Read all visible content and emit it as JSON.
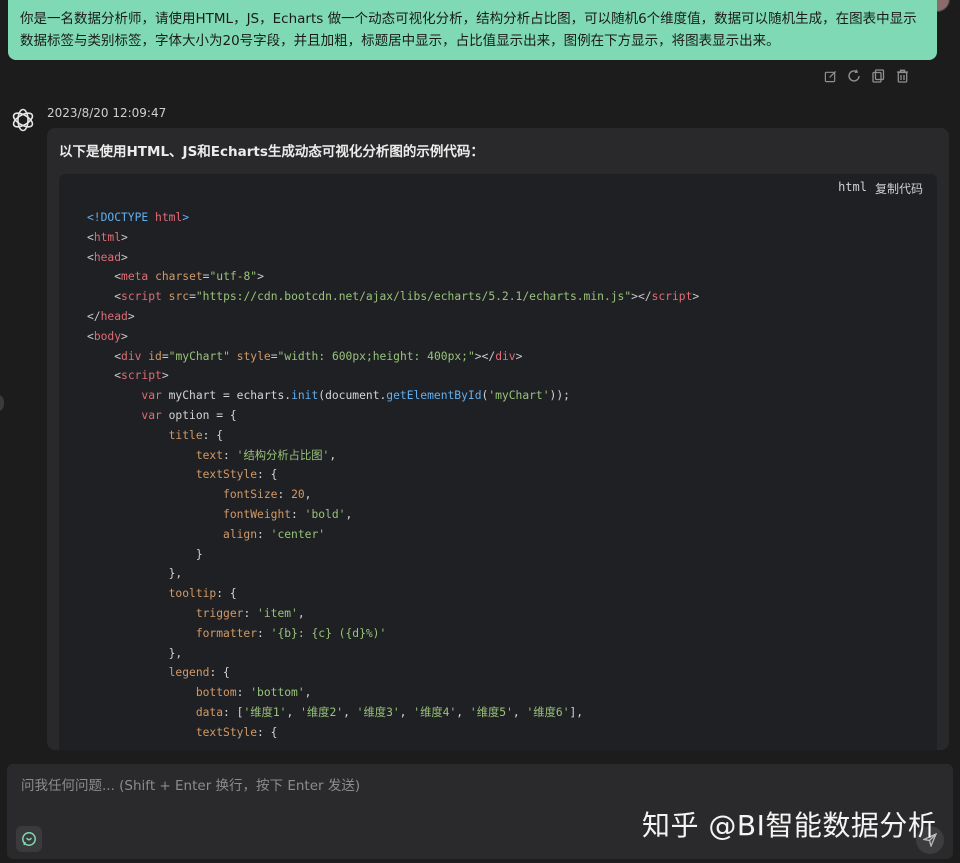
{
  "user_message": {
    "text": "你是一名数据分析师，请使用HTML，JS，Echarts 做一个动态可视化分析，结构分析占比图，可以随机6个维度值，数据可以随机生成，在图表中显示数据标签与类别标签，字体大小为20号字段，并且加粗，标题居中显示，占比值显示出来，图例在下方显示，将图表显示出来。",
    "background_color": "#7fd9b4"
  },
  "message_actions": [
    {
      "name": "edit-icon"
    },
    {
      "name": "regenerate-icon"
    },
    {
      "name": "copy-icon"
    },
    {
      "name": "delete-icon"
    }
  ],
  "assistant": {
    "logo_icon": "openai-logo-icon",
    "timestamp": "2023/8/20 12:09:47",
    "intro": "以下是使用HTML、JS和Echarts生成动态可视化分析图的示例代码：",
    "code_lang": "html",
    "copy_label": "复制代码",
    "code_lines": [
      [
        [
          "doctype",
          "<!DOCTYPE "
        ],
        [
          "tag",
          "html"
        ],
        [
          "doctype",
          ">"
        ]
      ],
      [
        [
          "punct",
          "<"
        ],
        [
          "tag",
          "html"
        ],
        [
          "punct",
          ">"
        ]
      ],
      [
        [
          "punct",
          "<"
        ],
        [
          "tag",
          "head"
        ],
        [
          "punct",
          ">"
        ]
      ],
      [
        [
          "plain",
          "    "
        ],
        [
          "punct",
          "<"
        ],
        [
          "tag",
          "meta"
        ],
        [
          "plain",
          " "
        ],
        [
          "attr",
          "charset"
        ],
        [
          "punct",
          "="
        ],
        [
          "str",
          "\"utf-8\""
        ],
        [
          "punct",
          ">"
        ]
      ],
      [
        [
          "plain",
          "    "
        ],
        [
          "punct",
          "<"
        ],
        [
          "tag",
          "script"
        ],
        [
          "plain",
          " "
        ],
        [
          "attr",
          "src"
        ],
        [
          "punct",
          "="
        ],
        [
          "str",
          "\"https://cdn.bootcdn.net/ajax/libs/echarts/5.2.1/echarts.min.js\""
        ],
        [
          "punct",
          "></"
        ],
        [
          "tag",
          "script"
        ],
        [
          "punct",
          ">"
        ]
      ],
      [
        [
          "punct",
          "</"
        ],
        [
          "tag",
          "head"
        ],
        [
          "punct",
          ">"
        ]
      ],
      [
        [
          "punct",
          "<"
        ],
        [
          "tag",
          "body"
        ],
        [
          "punct",
          ">"
        ]
      ],
      [
        [
          "plain",
          "    "
        ],
        [
          "punct",
          "<"
        ],
        [
          "tag",
          "div"
        ],
        [
          "plain",
          " "
        ],
        [
          "attr",
          "id"
        ],
        [
          "punct",
          "="
        ],
        [
          "str",
          "\"myChart\""
        ],
        [
          "plain",
          " "
        ],
        [
          "attr",
          "style"
        ],
        [
          "punct",
          "="
        ],
        [
          "str",
          "\"width: 600px;height: 400px;\""
        ],
        [
          "punct",
          "></"
        ],
        [
          "tag",
          "div"
        ],
        [
          "punct",
          ">"
        ]
      ],
      [
        [
          "plain",
          "    "
        ],
        [
          "punct",
          "<"
        ],
        [
          "tag",
          "script"
        ],
        [
          "punct",
          ">"
        ]
      ],
      [
        [
          "plain",
          "        "
        ],
        [
          "kw",
          "var"
        ],
        [
          "plain",
          " myChart = echarts."
        ],
        [
          "fn",
          "init"
        ],
        [
          "plain",
          "(document."
        ],
        [
          "fn",
          "getElementById"
        ],
        [
          "plain",
          "("
        ],
        [
          "str",
          "'myChart'"
        ],
        [
          "plain",
          "));"
        ]
      ],
      [
        [
          "plain",
          "        "
        ],
        [
          "kw",
          "var"
        ],
        [
          "plain",
          " option = {"
        ]
      ],
      [
        [
          "plain",
          "            "
        ],
        [
          "prop",
          "title"
        ],
        [
          "plain",
          ": {"
        ]
      ],
      [
        [
          "plain",
          "                "
        ],
        [
          "prop",
          "text"
        ],
        [
          "plain",
          ": "
        ],
        [
          "str",
          "'结构分析占比图'"
        ],
        [
          "plain",
          ","
        ]
      ],
      [
        [
          "plain",
          "                "
        ],
        [
          "prop",
          "textStyle"
        ],
        [
          "plain",
          ": {"
        ]
      ],
      [
        [
          "plain",
          "                    "
        ],
        [
          "prop",
          "fontSize"
        ],
        [
          "plain",
          ": "
        ],
        [
          "num",
          "20"
        ],
        [
          "plain",
          ","
        ]
      ],
      [
        [
          "plain",
          "                    "
        ],
        [
          "prop",
          "fontWeight"
        ],
        [
          "plain",
          ": "
        ],
        [
          "str",
          "'bold'"
        ],
        [
          "plain",
          ","
        ]
      ],
      [
        [
          "plain",
          "                    "
        ],
        [
          "prop",
          "align"
        ],
        [
          "plain",
          ": "
        ],
        [
          "str",
          "'center'"
        ]
      ],
      [
        [
          "plain",
          "                }"
        ]
      ],
      [
        [
          "plain",
          "            },"
        ]
      ],
      [
        [
          "plain",
          "            "
        ],
        [
          "prop",
          "tooltip"
        ],
        [
          "plain",
          ": {"
        ]
      ],
      [
        [
          "plain",
          "                "
        ],
        [
          "prop",
          "trigger"
        ],
        [
          "plain",
          ": "
        ],
        [
          "str",
          "'item'"
        ],
        [
          "plain",
          ","
        ]
      ],
      [
        [
          "plain",
          "                "
        ],
        [
          "prop",
          "formatter"
        ],
        [
          "plain",
          ": "
        ],
        [
          "str",
          "'{b}: {c} ({d}%)'"
        ]
      ],
      [
        [
          "plain",
          "            },"
        ]
      ],
      [
        [
          "plain",
          "            "
        ],
        [
          "prop",
          "legend"
        ],
        [
          "plain",
          ": {"
        ]
      ],
      [
        [
          "plain",
          "                "
        ],
        [
          "prop",
          "bottom"
        ],
        [
          "plain",
          ": "
        ],
        [
          "str",
          "'bottom'"
        ],
        [
          "plain",
          ","
        ]
      ],
      [
        [
          "plain",
          "                "
        ],
        [
          "prop",
          "data"
        ],
        [
          "plain",
          ": ["
        ],
        [
          "str",
          "'维度1'"
        ],
        [
          "plain",
          ", "
        ],
        [
          "str",
          "'维度2'"
        ],
        [
          "plain",
          ", "
        ],
        [
          "str",
          "'维度3'"
        ],
        [
          "plain",
          ", "
        ],
        [
          "str",
          "'维度4'"
        ],
        [
          "plain",
          ", "
        ],
        [
          "str",
          "'维度5'"
        ],
        [
          "plain",
          ", "
        ],
        [
          "str",
          "'维度6'"
        ],
        [
          "plain",
          "],"
        ]
      ],
      [
        [
          "plain",
          "                "
        ],
        [
          "prop",
          "textStyle"
        ],
        [
          "plain",
          ": {"
        ]
      ]
    ]
  },
  "input": {
    "placeholder": "问我任何问题... (Shift + Enter 换行，按下 Enter 发送)",
    "value": ""
  },
  "chat_mode_icon": "chat-bubble-icon",
  "send_icon": "send-icon",
  "watermark": "知乎 @BI智能数据分析"
}
